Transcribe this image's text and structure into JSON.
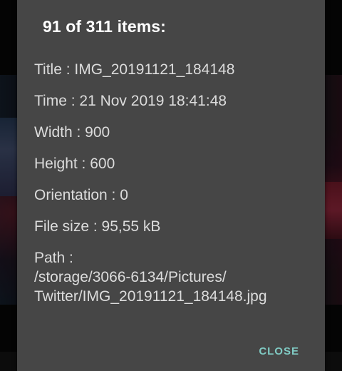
{
  "dialog": {
    "title": "91 of 311 items:",
    "details": {
      "title": "Title : IMG_20191121_184148",
      "time": "Time : 21 Nov 2019 18:41:48",
      "width": "Width : 900",
      "height": "Height : 600",
      "orientation": "Orientation : 0",
      "file_size": "File size : 95,55 kB",
      "path_label": "Path :",
      "path_line1": "/storage/3066-6134/Pictures/",
      "path_line2": "Twitter/IMG_20191121_184148.jpg"
    },
    "close_label": "CLOSE"
  },
  "colors": {
    "dialog_bg": "#464646",
    "accent": "#80cbc4",
    "text": "#dcdcdc",
    "title": "#ffffff"
  }
}
